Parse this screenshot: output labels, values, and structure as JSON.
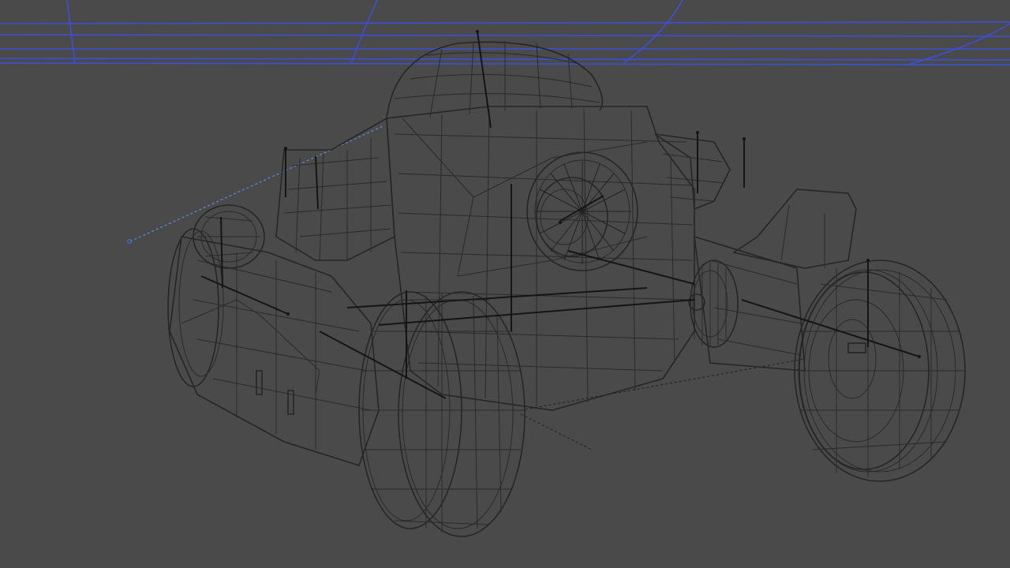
{
  "viewport": {
    "shading": "wireframe",
    "subject": "vehicle-model",
    "background_color": "#4a4a4a",
    "wire_color": "#2a2a2a",
    "grid_color": "#3d4fd6",
    "selection_line_color": "#5b8ee6"
  }
}
